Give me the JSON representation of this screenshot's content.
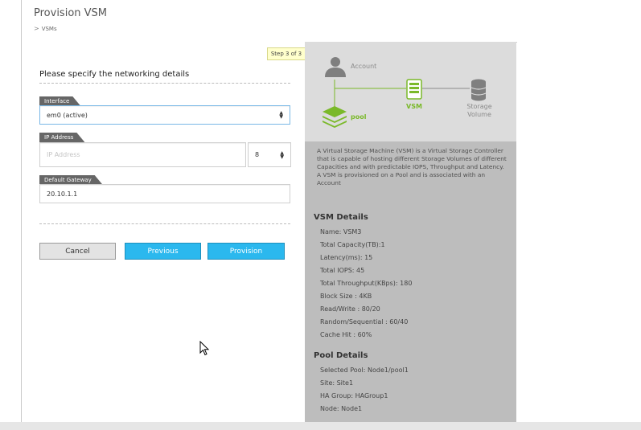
{
  "header": {
    "title": "Provision VSM",
    "breadcrumb": "VSMs"
  },
  "wizard": {
    "step": "Step 3 of 3",
    "heading": "Please specify the networking details",
    "interface": {
      "label": "Interface",
      "value": "em0 (active)"
    },
    "ip": {
      "label": "IP Address",
      "placeholder": "IP Address",
      "prefix": "8"
    },
    "gateway": {
      "label": "Default Gateway",
      "value": "20.10.1.1"
    },
    "buttons": {
      "cancel": "Cancel",
      "previous": "Previous",
      "provision": "Provision"
    }
  },
  "diagram": {
    "account": "Account",
    "vsm": "VSM",
    "storage_line1": "Storage",
    "storage_line2": "Volume",
    "pool": "pool",
    "colors": {
      "green": "#7ab929",
      "grey": "#7f7f7f"
    }
  },
  "info": {
    "description": "A Virtual Storage Machine (VSM) is a Virtual Storage Controller that is capable of hosting different Storage Volumes of different Capacities and with predictable IOPS, Throughput and Latency. A VSM is provisioned on a Pool and is associated with an Account",
    "vsm_heading": "VSM Details",
    "vsm_details": [
      "Name: VSM3",
      "Total Capacity(TB):1",
      "Latency(ms): 15",
      "Total IOPS: 45",
      "Total Throughput(KBps): 180",
      "Block Size : 4KB",
      "Read/Write : 80/20",
      "Random/Sequential : 60/40",
      "Cache Hit : 60%"
    ],
    "pool_heading": "Pool Details",
    "pool_details": [
      "Selected Pool: Node1/pool1",
      "Site: Site1",
      "HA Group: HAGroup1",
      "Node: Node1"
    ]
  }
}
